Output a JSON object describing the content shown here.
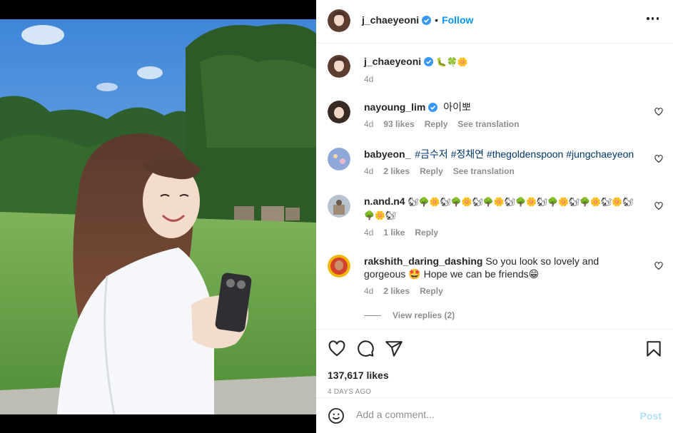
{
  "post_author": {
    "username": "j_chaeyeoni",
    "verified": true,
    "follow_label": "Follow",
    "separator": "•"
  },
  "caption": {
    "username": "j_chaeyeoni",
    "text": "🐛🍀🌼",
    "time": "4d"
  },
  "comments": [
    {
      "username": "nayoung_lim",
      "verified": true,
      "text": "아이뽀",
      "time": "4d",
      "likes": "93 likes",
      "reply": "Reply",
      "translate": "See translation"
    },
    {
      "username": "babyeon_",
      "verified": false,
      "text_parts": [
        "#금수저",
        "#정채연",
        "#thegoldenspoon",
        "#jungchaeyeon"
      ],
      "time": "4d",
      "likes": "2 likes",
      "reply": "Reply",
      "translate": "See translation"
    },
    {
      "username": "n.and.n4",
      "verified": false,
      "text": "🐿🌳🌼🐿🌳🌼🐿🌳🌼🐿🌳🌼🐿🌳🌼🐿🌳🌼🐿🌼🐿🌳🌼🐿",
      "time": "4d",
      "likes": "1 like",
      "reply": "Reply"
    },
    {
      "username": "rakshith_daring_dashing",
      "verified": false,
      "text": "So you look so lovely and gorgeous 🤩 Hope we can be friends😁",
      "time": "4d",
      "likes": "2 likes",
      "reply": "Reply"
    }
  ],
  "view_replies": "View replies (2)",
  "actions": {
    "like_icon": "heart-icon",
    "comment_icon": "comment-icon",
    "share_icon": "share-icon",
    "save_icon": "bookmark-icon"
  },
  "likes_count": "137,617 likes",
  "posted_ago": "4 DAYS AGO",
  "add_comment": {
    "placeholder": "Add a comment...",
    "post_label": "Post"
  },
  "colors": {
    "accent": "#0095f6",
    "verified": "#3897f0",
    "muted": "#8e8e8e",
    "post_disabled": "#b2dffc"
  }
}
